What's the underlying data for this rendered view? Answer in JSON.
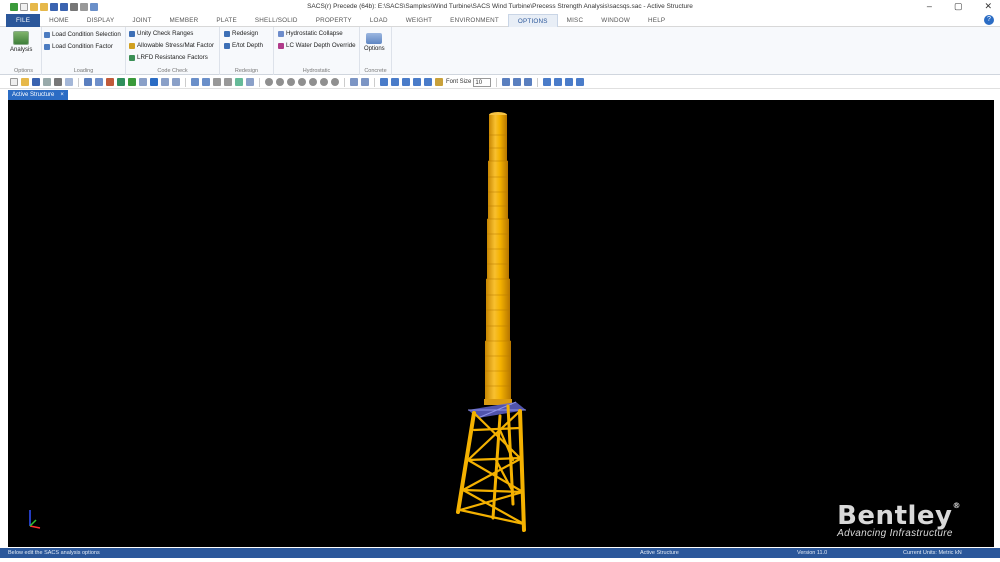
{
  "window": {
    "title": "SACS(r) Precede (64b): E:\\SACS\\Samples\\Wind Turbine\\SACS Wind Turbine\\Precess Strength Analysis\\sacsqs.sac - Active Structure",
    "minimize": "–",
    "maximize": "▢",
    "close": "✕"
  },
  "menu_tabs": [
    "FILE",
    "HOME",
    "DISPLAY",
    "JOINT",
    "MEMBER",
    "PLATE",
    "SHELL/SOLID",
    "PROPERTY",
    "LOAD",
    "WEIGHT",
    "ENVIRONMENT",
    "OPTIONS",
    "MISC",
    "WINDOW",
    "HELP"
  ],
  "active_tab": "OPTIONS",
  "ribbon": {
    "options_group": {
      "label": "Options",
      "analysis_button": "Analysis"
    },
    "loading_group": {
      "label": "Loading",
      "items": [
        "Load Condition Selection",
        "Load Condition Factor"
      ]
    },
    "code_check_group": {
      "label": "Code Check",
      "items": [
        "Unity Check Ranges",
        "Allowable Stress/Mat Factor",
        "LRFD Resistance Factors"
      ]
    },
    "redesign_group": {
      "label": "Redesign",
      "items": [
        "Redesign",
        "E/tot Depth"
      ]
    },
    "hydrostatic_group": {
      "label": "Hydrostatic",
      "items": [
        "Hydrostatic Collapse",
        "LC Water Depth Override"
      ]
    },
    "concrete_group": {
      "label": "Concrete",
      "options_button": "Options"
    }
  },
  "toolbar": {
    "font_size_label": "Font Size",
    "font_size_value": "10"
  },
  "document_tab": {
    "label": "Active Structure",
    "close": "×"
  },
  "status_bar": {
    "hint": "Below edit the SACS analysis options",
    "structure": "Active Structure",
    "version": "Version 11.0",
    "units": "Current Units: Metric kN"
  },
  "logo": {
    "name": "Bentley",
    "registered": "®",
    "tagline": "Advancing Infrastructure"
  },
  "colors": {
    "accent": "#2b579a",
    "structure": "#f5b400",
    "viewport": "#000000",
    "mudmat": "#5f63c9"
  }
}
